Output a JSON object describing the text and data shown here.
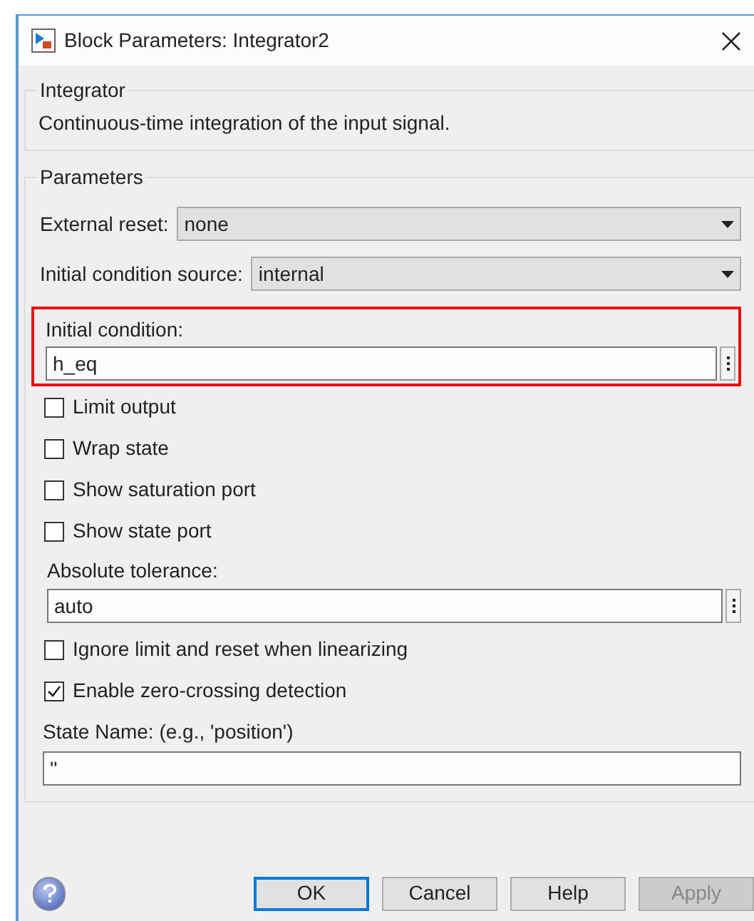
{
  "window": {
    "title": "Block Parameters: Integrator2"
  },
  "description_group": {
    "title": "Integrator",
    "text": "Continuous-time integration of the input signal."
  },
  "parameters_group": {
    "title": "Parameters",
    "dropdowns": [
      {
        "label": "External reset:",
        "value": "none"
      },
      {
        "label": "Initial condition source:",
        "value": "internal"
      }
    ],
    "initial_condition": {
      "label": "Initial condition:",
      "value": "h_eq",
      "highlighted": true
    },
    "checkboxes_top": [
      {
        "label": "Limit output",
        "checked": false
      },
      {
        "label": "Wrap state",
        "checked": false
      },
      {
        "label": "Show saturation port",
        "checked": false
      },
      {
        "label": "Show state port",
        "checked": false
      }
    ],
    "absolute_tolerance": {
      "label": "Absolute tolerance:",
      "value": "auto"
    },
    "checkboxes_bottom": [
      {
        "label": "Ignore limit and reset when linearizing",
        "checked": false
      },
      {
        "label": "Enable zero-crossing detection",
        "checked": true
      }
    ],
    "state_name": {
      "label": "State Name: (e.g., 'position')",
      "value": "''"
    }
  },
  "buttons": [
    {
      "label": "OK",
      "kind": "default",
      "disabled": false
    },
    {
      "label": "Cancel",
      "kind": "normal",
      "disabled": false
    },
    {
      "label": "Help",
      "kind": "normal",
      "disabled": false
    },
    {
      "label": "Apply",
      "kind": "normal",
      "disabled": true
    }
  ]
}
